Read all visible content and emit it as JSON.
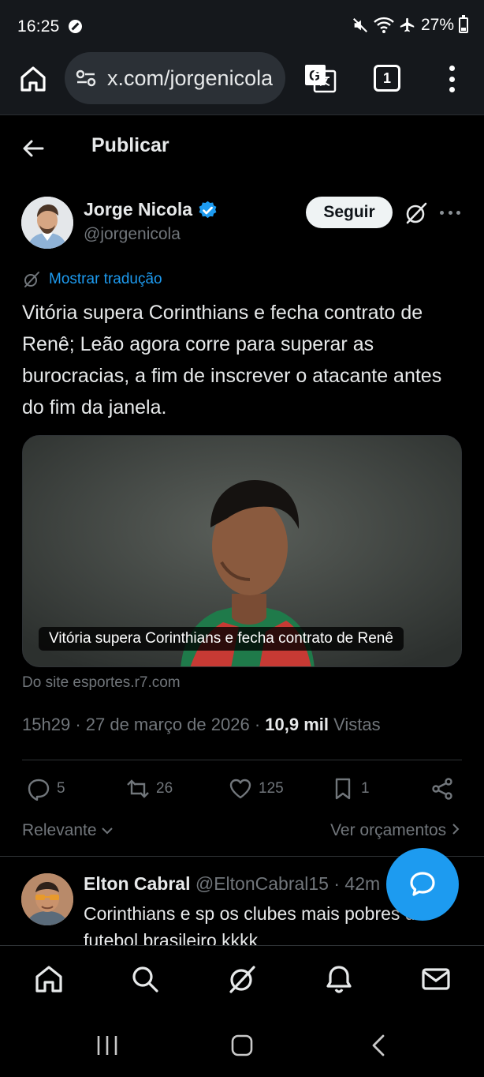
{
  "status_bar": {
    "time": "16:25",
    "battery": "27%"
  },
  "browser": {
    "url": "x.com/jorgenicola",
    "tab_count": "1"
  },
  "header": {
    "title": "Publicar"
  },
  "tweet": {
    "author_name": "Jorge Nicola",
    "author_handle": "@jorgenicola",
    "follow_label": "Seguir",
    "translate_label": "Mostrar tradução",
    "text": "Vitória supera Corinthians e fecha contrato de Renê; Leão agora corre para superar as burocracias, a fim de inscrever o atacante antes do fim da janela.",
    "card_caption": "Vitória supera Corinthians e fecha contrato de Renê",
    "card_source": "Do site esportes.r7.com",
    "time": "15h29",
    "date": "27 de março de 2026",
    "views_count": "10,9 mil",
    "views_label": "Vistas",
    "replies": "5",
    "reposts": "26",
    "likes": "125",
    "bookmarks": "1"
  },
  "filters": {
    "relevant": "Relevante",
    "budget": "Ver orçamentos"
  },
  "reply": {
    "name": "Elton Cabral",
    "handle": "@EltonCabral15",
    "time": "42m",
    "text": "Corinthians e sp os clubes mais pobres do futebol brasileiro kkkk"
  },
  "colors": {
    "accent": "#1d9bf0",
    "background": "#000000",
    "muted_text": "#71767b"
  }
}
